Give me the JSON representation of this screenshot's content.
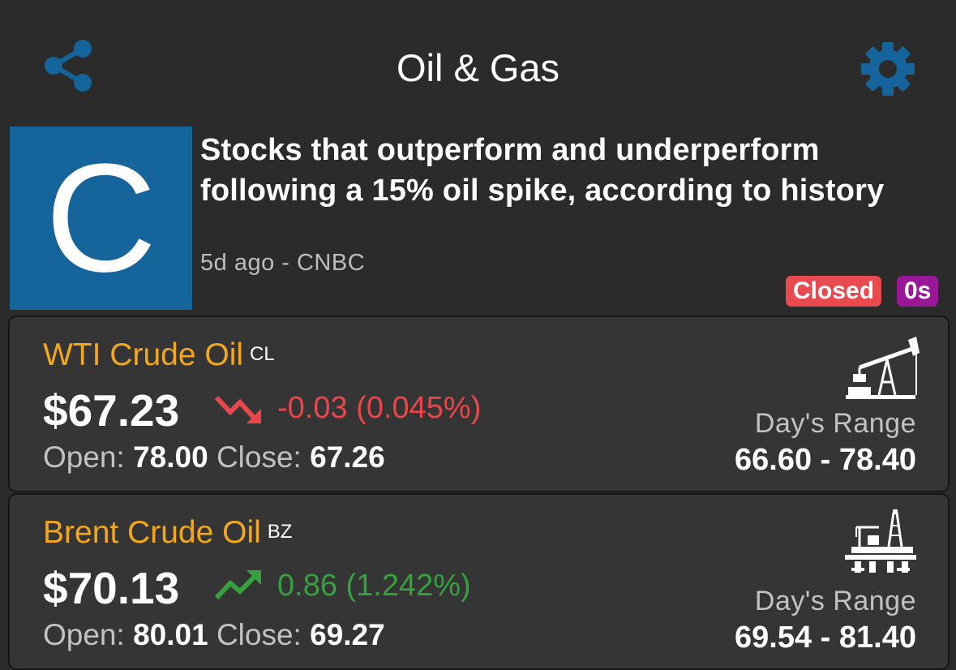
{
  "header": {
    "title": "Oil & Gas",
    "share_icon": "share-icon",
    "settings_icon": "gear-icon",
    "accent_color": "#15649b"
  },
  "news": {
    "thumbnail_letter": "C",
    "headline": "Stocks that outperform and underperform following a 15% oil spike, according to history",
    "meta": "5d ago - CNBC",
    "status_badge": "Closed",
    "status_badge_color": "#e84a4f",
    "timer_badge": "0s",
    "timer_badge_color": "#9a1898"
  },
  "commodities": [
    {
      "name": "WTI Crude Oil",
      "symbol": "CL",
      "price": "$67.23",
      "change": "-0.03 (0.045%)",
      "direction": "down",
      "open_label": "Open:",
      "open": "78.00",
      "close_label": "Close:",
      "close": "67.26",
      "range_label": "Day's Range",
      "range": "66.60 - 78.40",
      "icon": "oil-pump-jack-icon"
    },
    {
      "name": "Brent Crude Oil",
      "symbol": "BZ",
      "price": "$70.13",
      "change": "0.86 (1.242%)",
      "direction": "up",
      "open_label": "Open:",
      "open": "80.01",
      "close_label": "Close:",
      "close": "69.27",
      "range_label": "Day's Range",
      "range": "69.54 - 81.40",
      "icon": "offshore-oil-rig-icon"
    }
  ],
  "colors": {
    "name": "#f2a81e",
    "negative": "#e8474c",
    "positive": "#37a03f"
  }
}
